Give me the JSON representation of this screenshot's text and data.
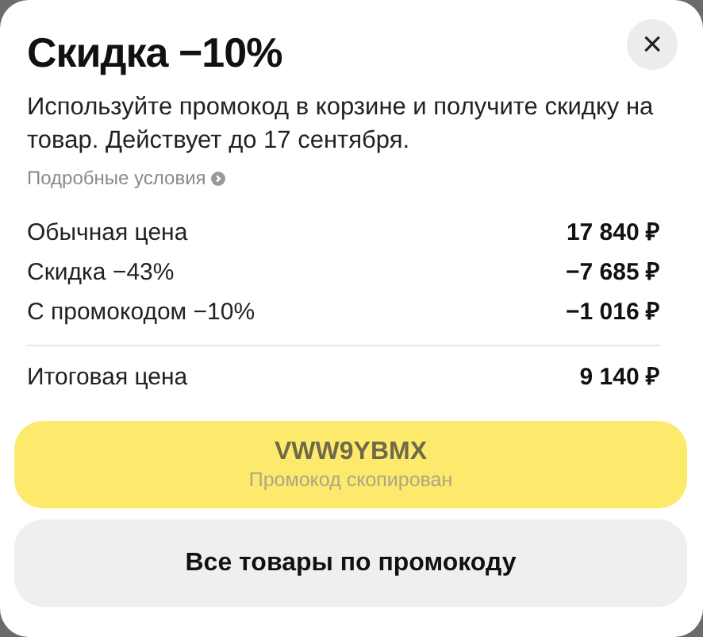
{
  "title": "Скидка −10%",
  "close": "×",
  "description": "Используйте промокод в корзине и получите скидку на товар. Действует до 17 сентября.",
  "details_link": "Подробные условия",
  "rows": [
    {
      "label": "Обычная цена",
      "value": "17 840 ₽"
    },
    {
      "label": "Скидка −43%",
      "value": "−7 685 ₽"
    },
    {
      "label": "С промокодом −10%",
      "value": "−1 016 ₽"
    }
  ],
  "total": {
    "label": "Итоговая цена",
    "value": "9 140 ₽"
  },
  "promo_button": {
    "code": "VWW9YBMX",
    "status": "Промокод скопирован"
  },
  "all_products_button": "Все товары по промокоду"
}
